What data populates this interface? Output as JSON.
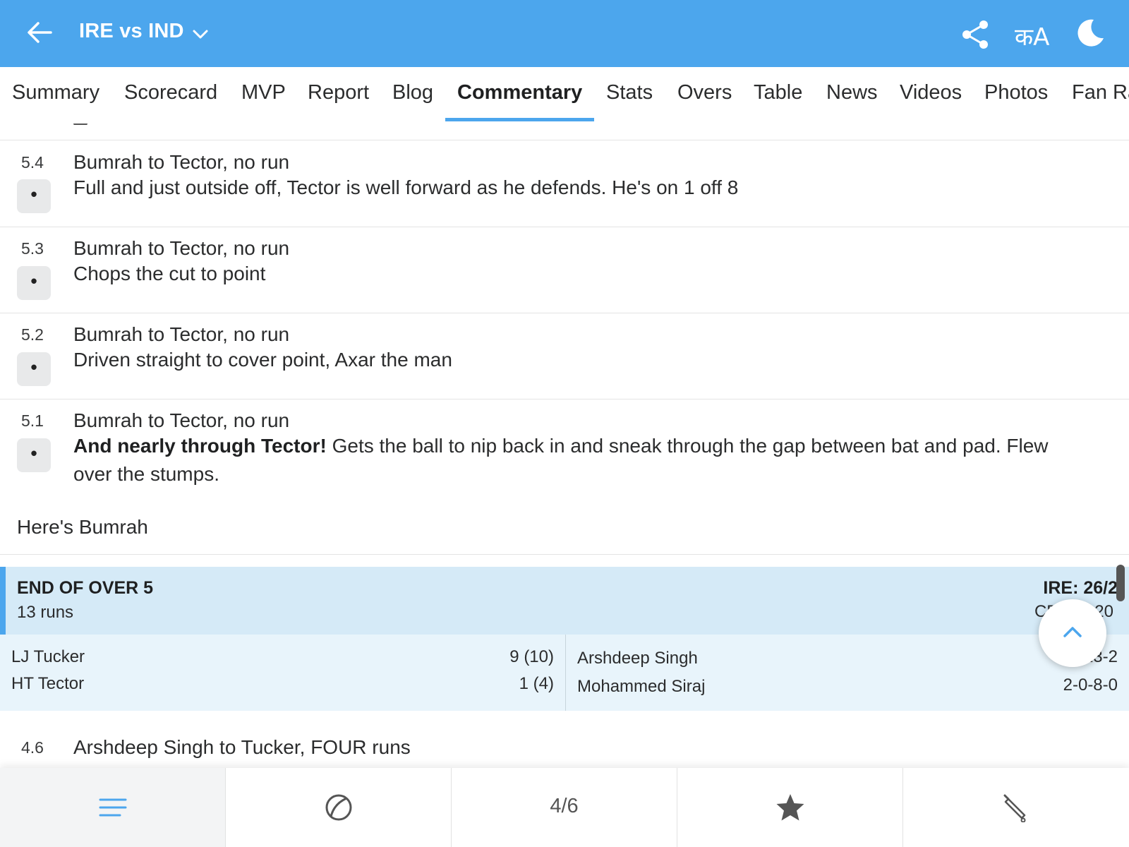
{
  "header": {
    "title": "IRE vs IND",
    "lang_label": "कA",
    "bg_color": "#4ca6ed"
  },
  "tabs": [
    {
      "label": "Summary"
    },
    {
      "label": "Scorecard"
    },
    {
      "label": "MVP"
    },
    {
      "label": "Report"
    },
    {
      "label": "Blog"
    },
    {
      "label": "Commentary",
      "active": true
    },
    {
      "label": "Stats"
    },
    {
      "label": "Overs"
    },
    {
      "label": "Table"
    },
    {
      "label": "News"
    },
    {
      "label": "Videos"
    },
    {
      "label": "Photos"
    },
    {
      "label": "Fan Ra"
    }
  ],
  "commentary": [
    {
      "over": "5.4",
      "result": "•",
      "headline": "Bumrah to Tector, no run",
      "text": "Full and just outside off, Tector is well forward as he defends. He's on 1 off 8"
    },
    {
      "over": "5.3",
      "result": "•",
      "headline": "Bumrah to Tector, no run",
      "text": "Chops the cut to point"
    },
    {
      "over": "5.2",
      "result": "•",
      "headline": "Bumrah to Tector, no run",
      "text": "Driven straight to cover point, Axar the man"
    },
    {
      "over": "5.1",
      "result": "•",
      "headline": "Bumrah to Tector, no run",
      "bold": "And nearly through Tector!",
      "text": " Gets the ball to nip back in and sneak through the gap between bat and pad. Flew over the stumps."
    }
  ],
  "note": "Here's Bumrah",
  "end_of_over": {
    "title": "END OF OVER 5",
    "runs": "13 runs",
    "score": "IRE: 26/2",
    "crr": "CRR: 5.20",
    "batters": [
      {
        "name": "LJ Tucker",
        "score": "9 (10)"
      },
      {
        "name": "HT Tector",
        "score": "1 (4)"
      }
    ],
    "bowlers": [
      {
        "name": "Arshdeep Singh",
        "figures": "3-0-13-2"
      },
      {
        "name": "Mohammed Siraj",
        "figures": "2-0-8-0"
      }
    ]
  },
  "next_ball": {
    "over": "4.6",
    "headline": "Arshdeep Singh to Tucker, FOUR runs"
  },
  "bottom_nav": {
    "page_indicator": "4/6",
    "items": [
      "menu-icon",
      "ball-icon",
      "page-indicator",
      "star-icon",
      "bat-icon"
    ]
  }
}
